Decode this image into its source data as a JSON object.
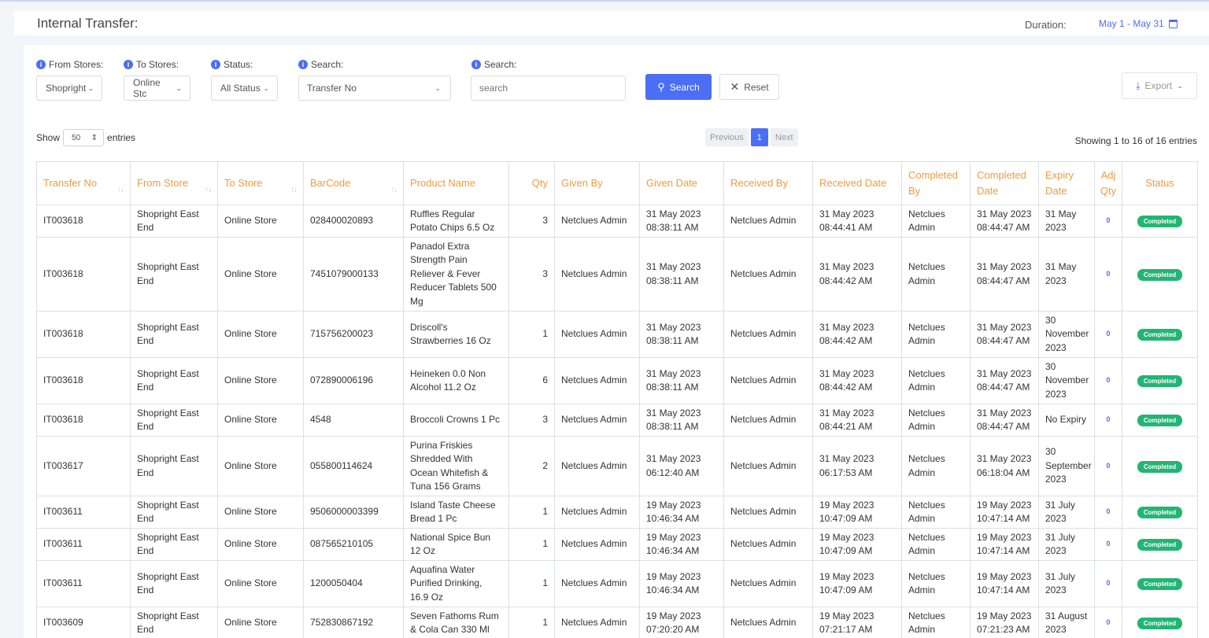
{
  "header": {
    "title": "Internal Transfer:",
    "duration_label": "Duration:",
    "duration_value": "May 1 - May 31"
  },
  "filters": {
    "from_stores": {
      "label": "From Stores:",
      "value": "Shopright"
    },
    "to_stores": {
      "label": "To Stores:",
      "value": "Online Stc"
    },
    "status": {
      "label": "Status:",
      "value": "All Status"
    },
    "search_by": {
      "label": "Search:",
      "value": "Transfer No"
    },
    "search_text": {
      "label": "Search:",
      "placeholder": "search"
    },
    "search_button": "Search",
    "reset_button": "Reset",
    "export_button": "Export"
  },
  "listing": {
    "show_label": "Show",
    "entries_value": "50",
    "entries_label": "entries",
    "prev": "Previous",
    "page": "1",
    "next": "Next",
    "showing": "Showing 1 to 16 of 16 entries"
  },
  "table": {
    "columns": [
      "Transfer No",
      "From Store",
      "To Store",
      "BarCode",
      "Product Name",
      "Qty",
      "Given By",
      "Given Date",
      "Received By",
      "Received Date",
      "Completed By",
      "Completed Date",
      "Expiry Date",
      "Adj Qty",
      "Status"
    ],
    "rows": [
      {
        "transfer_no": "IT003618",
        "from_store": "Shopright East End",
        "to_store": "Online Store",
        "barcode": "028400020893",
        "product": "Ruffles Regular Potato Chips 6.5 Oz",
        "qty": "3",
        "given_by": "Netclues Admin",
        "given_date": "31 May 2023 08:38:11 AM",
        "received_by": "Netclues Admin",
        "received_date": "31 May 2023 08:44:41 AM",
        "completed_by": "Netclues Admin",
        "completed_date": "31 May 2023 08:44:47 AM",
        "expiry": "31 May 2023",
        "adj_qty": "0",
        "status": "Completed"
      },
      {
        "transfer_no": "IT003618",
        "from_store": "Shopright East End",
        "to_store": "Online Store",
        "barcode": "7451079000133",
        "product": "Panadol Extra Strength Pain Reliever & Fever Reducer Tablets 500 Mg",
        "qty": "3",
        "given_by": "Netclues Admin",
        "given_date": "31 May 2023 08:38:11 AM",
        "received_by": "Netclues Admin",
        "received_date": "31 May 2023 08:44:42 AM",
        "completed_by": "Netclues Admin",
        "completed_date": "31 May 2023 08:44:47 AM",
        "expiry": "31 May 2023",
        "adj_qty": "0",
        "status": "Completed"
      },
      {
        "transfer_no": "IT003618",
        "from_store": "Shopright East End",
        "to_store": "Online Store",
        "barcode": "715756200023",
        "product": "Driscoll's Strawberries 16 Oz",
        "qty": "1",
        "given_by": "Netclues Admin",
        "given_date": "31 May 2023 08:38:11 AM",
        "received_by": "Netclues Admin",
        "received_date": "31 May 2023 08:44:42 AM",
        "completed_by": "Netclues Admin",
        "completed_date": "31 May 2023 08:44:47 AM",
        "expiry": "30 November 2023",
        "adj_qty": "0",
        "status": "Completed"
      },
      {
        "transfer_no": "IT003618",
        "from_store": "Shopright East End",
        "to_store": "Online Store",
        "barcode": "072890006196",
        "product": "Heineken 0.0 Non Alcohol 11.2 Oz",
        "qty": "6",
        "given_by": "Netclues Admin",
        "given_date": "31 May 2023 08:38:11 AM",
        "received_by": "Netclues Admin",
        "received_date": "31 May 2023 08:44:42 AM",
        "completed_by": "Netclues Admin",
        "completed_date": "31 May 2023 08:44:47 AM",
        "expiry": "30 November 2023",
        "adj_qty": "0",
        "status": "Completed"
      },
      {
        "transfer_no": "IT003618",
        "from_store": "Shopright East End",
        "to_store": "Online Store",
        "barcode": "4548",
        "product": "Broccoli Crowns 1 Pc",
        "qty": "3",
        "given_by": "Netclues Admin",
        "given_date": "31 May 2023 08:38:11 AM",
        "received_by": "Netclues Admin",
        "received_date": "31 May 2023 08:44:21 AM",
        "completed_by": "Netclues Admin",
        "completed_date": "31 May 2023 08:44:47 AM",
        "expiry": "No Expiry",
        "adj_qty": "0",
        "status": "Completed"
      },
      {
        "transfer_no": "IT003617",
        "from_store": "Shopright East End",
        "to_store": "Online Store",
        "barcode": "055800114624",
        "product": "Purina Friskies Shredded With Ocean Whitefish & Tuna 156 Grams",
        "qty": "2",
        "given_by": "Netclues Admin",
        "given_date": "31 May 2023 06:12:40 AM",
        "received_by": "Netclues Admin",
        "received_date": "31 May 2023 06:17:53 AM",
        "completed_by": "Netclues Admin",
        "completed_date": "31 May 2023 06:18:04 AM",
        "expiry": "30 September 2023",
        "adj_qty": "0",
        "status": "Completed"
      },
      {
        "transfer_no": "IT003611",
        "from_store": "Shopright East End",
        "to_store": "Online Store",
        "barcode": "9506000003399",
        "product": "Island Taste Cheese Bread 1 Pc",
        "qty": "1",
        "given_by": "Netclues Admin",
        "given_date": "19 May 2023 10:46:34 AM",
        "received_by": "Netclues Admin",
        "received_date": "19 May 2023 10:47:09 AM",
        "completed_by": "Netclues Admin",
        "completed_date": "19 May 2023 10:47:14 AM",
        "expiry": "31 July 2023",
        "adj_qty": "0",
        "status": "Completed"
      },
      {
        "transfer_no": "IT003611",
        "from_store": "Shopright East End",
        "to_store": "Online Store",
        "barcode": "087565210105",
        "product": "National Spice Bun 12 Oz",
        "qty": "1",
        "given_by": "Netclues Admin",
        "given_date": "19 May 2023 10:46:34 AM",
        "received_by": "Netclues Admin",
        "received_date": "19 May 2023 10:47:09 AM",
        "completed_by": "Netclues Admin",
        "completed_date": "19 May 2023 10:47:14 AM",
        "expiry": "31 July 2023",
        "adj_qty": "0",
        "status": "Completed"
      },
      {
        "transfer_no": "IT003611",
        "from_store": "Shopright East End",
        "to_store": "Online Store",
        "barcode": "1200050404",
        "product": "Aquafina Water Purified Drinking, 16.9 Oz",
        "qty": "1",
        "given_by": "Netclues Admin",
        "given_date": "19 May 2023 10:46:34 AM",
        "received_by": "Netclues Admin",
        "received_date": "19 May 2023 10:47:09 AM",
        "completed_by": "Netclues Admin",
        "completed_date": "19 May 2023 10:47:14 AM",
        "expiry": "31 July 2023",
        "adj_qty": "0",
        "status": "Completed"
      },
      {
        "transfer_no": "IT003609",
        "from_store": "Shopright East End",
        "to_store": "Online Store",
        "barcode": "752830867192",
        "product": "Seven Fathoms Rum & Cola Can 330 Ml",
        "qty": "1",
        "given_by": "Netclues Admin",
        "given_date": "19 May 2023 07:20:20 AM",
        "received_by": "Netclues Admin",
        "received_date": "19 May 2023 07:21:17 AM",
        "completed_by": "Netclues Admin",
        "completed_date": "19 May 2023 07:21:23 AM",
        "expiry": "31 August 2023",
        "adj_qty": "0",
        "status": "Completed"
      }
    ]
  }
}
